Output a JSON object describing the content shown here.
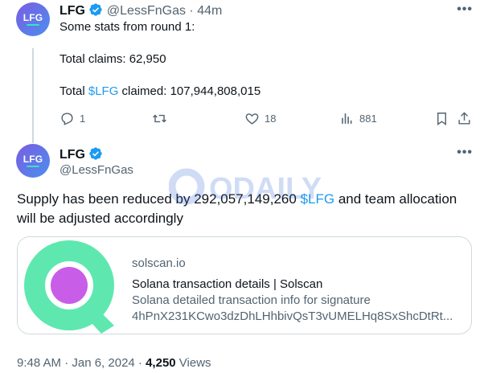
{
  "tweet1": {
    "avatar_text": "LFG",
    "display_name": "LFG",
    "handle": "@LessFnGas",
    "time": "44m",
    "line1": "Some stats from round 1:",
    "line2": "Total claims: 62,950",
    "line3_pre": "Total ",
    "line3_link": "$LFG",
    "line3_post": " claimed: 107,944,808,015",
    "actions": {
      "replies": "1",
      "retweets": "",
      "likes": "18",
      "views": "881"
    }
  },
  "tweet2": {
    "avatar_text": "LFG",
    "display_name": "LFG",
    "handle": "@LessFnGas",
    "body_pre": "Supply has been reduced by  292,057,149,260 ",
    "body_link": "$LFG",
    "body_post": " and team allocation will be adjusted accordingly",
    "card": {
      "domain": "solscan.io",
      "title": "Solana transaction details | Solscan",
      "description": "Solana detailed transaction info for signature 4hPnX231KCwo3dzDhLHhbivQsT3vUMELHq8SxShcDtRt..."
    },
    "timestamp": "9:48 AM · Jan 6, 2024 · ",
    "views_count": "4,250",
    "views_label": " Views"
  },
  "watermark_text": "ODAILY",
  "colors": {
    "text": "#0f1419",
    "muted": "#536471",
    "accent": "#1d9bf0",
    "border": "#cfd9de",
    "solscan_green": "#5ee8b0",
    "solscan_purple": "#c85de8"
  },
  "icons": [
    "verified-badge-icon",
    "more-icon",
    "reply-icon",
    "retweet-icon",
    "like-icon",
    "views-icon",
    "bookmark-icon",
    "share-icon"
  ]
}
